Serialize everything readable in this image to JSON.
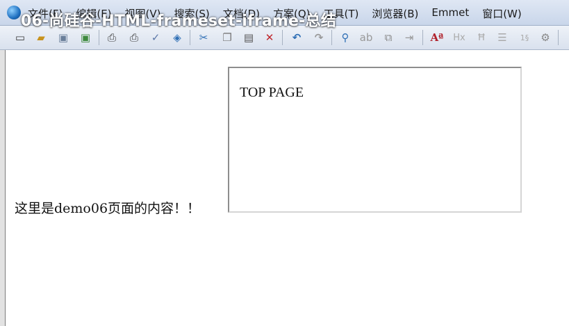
{
  "overlay": {
    "title": "06-尚硅谷-HTML-frameset-iframe-总结"
  },
  "menubar": {
    "items": [
      {
        "label": "文件(F)"
      },
      {
        "label": "编辑(E)"
      },
      {
        "label": "视图(V)"
      },
      {
        "label": "搜索(S)"
      },
      {
        "label": "文档(D)"
      },
      {
        "label": "方案(Q)"
      },
      {
        "label": "工具(T)"
      },
      {
        "label": "浏览器(B)"
      },
      {
        "label": "Emmet"
      },
      {
        "label": "窗口(W)"
      }
    ]
  },
  "toolbar": {
    "icons": [
      "new-file-icon",
      "open-folder-icon",
      "save-icon",
      "save-all-icon",
      "print-preview-icon",
      "print-icon",
      "spellcheck-icon",
      "browser-preview-icon",
      "cut-icon",
      "copy-icon",
      "paste-icon",
      "delete-icon",
      "undo-icon",
      "redo-icon",
      "find-icon",
      "replace-icon",
      "find-in-files-icon",
      "goto-line-icon",
      "font-size-icon",
      "heading-icon",
      "strikethrough-icon",
      "list-icon",
      "number-icon",
      "settings-icon"
    ]
  },
  "page": {
    "content_text": "这里是demo06页面的内容！！",
    "iframe_text": "TOP PAGE"
  }
}
